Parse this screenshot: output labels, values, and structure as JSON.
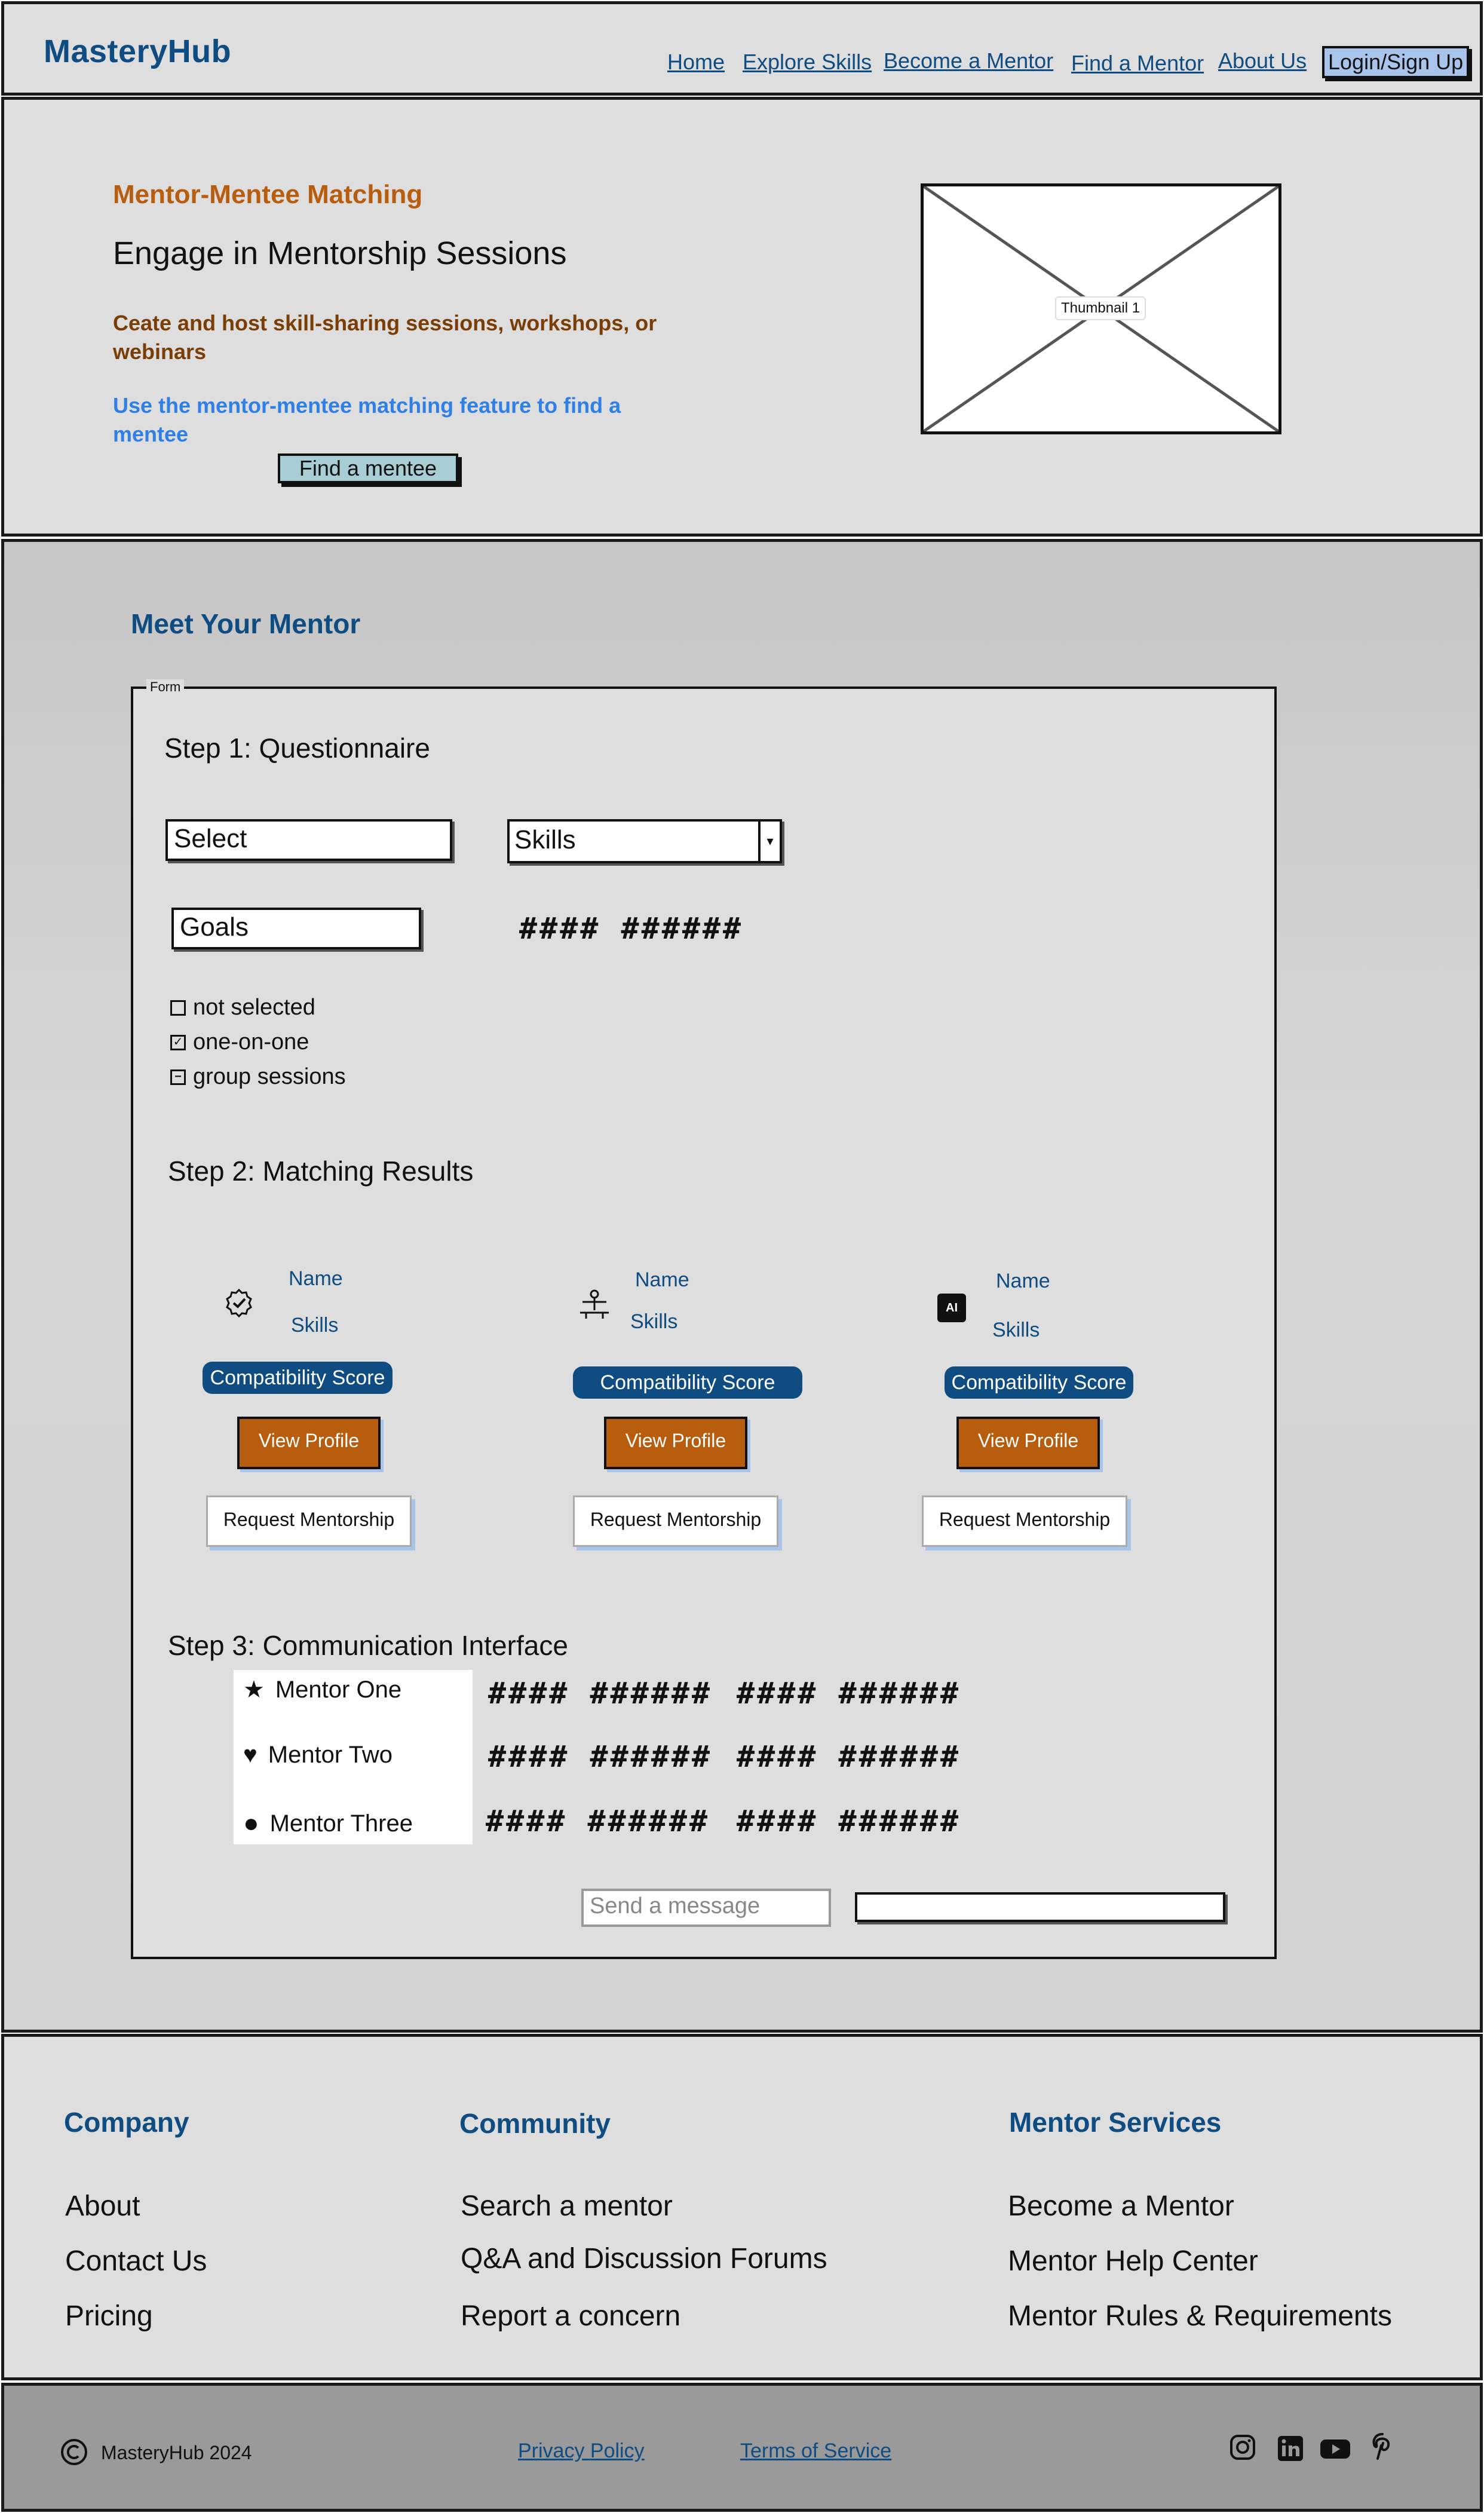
{
  "header": {
    "brand": "MasteryHub",
    "nav": [
      "Home",
      "Explore Skills",
      "Become a Mentor",
      "Find a Mentor",
      "About Us"
    ],
    "login": "Login/Sign Up"
  },
  "hero": {
    "eyebrow": "Mentor-Mentee Matching",
    "title": "Engage in Mentorship Sessions",
    "brown_text": "Ceate and host skill-sharing sessions, workshops, or webinars",
    "blue_text": "Use the mentor-mentee matching feature to find a mentee",
    "button": "Find a mentee",
    "thumbnail_label": "Thumbnail 1"
  },
  "meet": {
    "title": "Meet Your Mentor",
    "form_legend": "Form",
    "step1": "Step 1: Questionnaire",
    "select_value": "Select",
    "skills_value": "Skills",
    "goals_value": "Goals",
    "hash_text": "#### ######",
    "checkboxes": [
      "not selected",
      "one-on-one",
      "group sessions"
    ],
    "step2": "Step 2: Matching Results",
    "cards": [
      {
        "name": "Name",
        "skills": "Skills",
        "score": "Compatibility Score",
        "view": "View Profile",
        "request": "Request Mentorship",
        "icon": "badge-check-icon"
      },
      {
        "name": "Name",
        "skills": "Skills",
        "score": "Compatibility Score",
        "view": "View Profile",
        "request": "Request Mentorship",
        "icon": "mentor-person-icon"
      },
      {
        "name": "Name",
        "skills": "Skills",
        "score": "Compatibility Score",
        "view": "View Profile",
        "request": "Request Mentorship",
        "icon": "ai-chip-icon"
      }
    ],
    "step3": "Step 3: Communication Interface",
    "chat_contacts": [
      "Mentor One",
      "Mentor Two",
      "Mentor Three"
    ],
    "chat_hash": "#### ######",
    "send_placeholder": "Send a message"
  },
  "footer": {
    "columns": [
      {
        "heading": "Company",
        "links": [
          "About",
          "Contact Us",
          "Pricing"
        ]
      },
      {
        "heading": "Community",
        "links": [
          "Search a mentor",
          "Q&A and Discussion Forums",
          "Report a concern"
        ]
      },
      {
        "heading": "Mentor Services",
        "links": [
          "Become a Mentor",
          "Mentor Help Center",
          "Mentor Rules & Requirements"
        ]
      }
    ],
    "copyright": "MasteryHub 2024",
    "privacy": "Privacy Policy",
    "terms": "Terms of Service",
    "social_icons": [
      "instagram-icon",
      "linkedin-icon",
      "youtube-icon",
      "pinterest-icon"
    ]
  },
  "colors": {
    "brand_blue": "#0f4c81",
    "accent_orange": "#b85c0e",
    "light_blue": "#a9c4eb",
    "panel_gray": "#dedede",
    "footer_gray": "#9a9a9a"
  }
}
